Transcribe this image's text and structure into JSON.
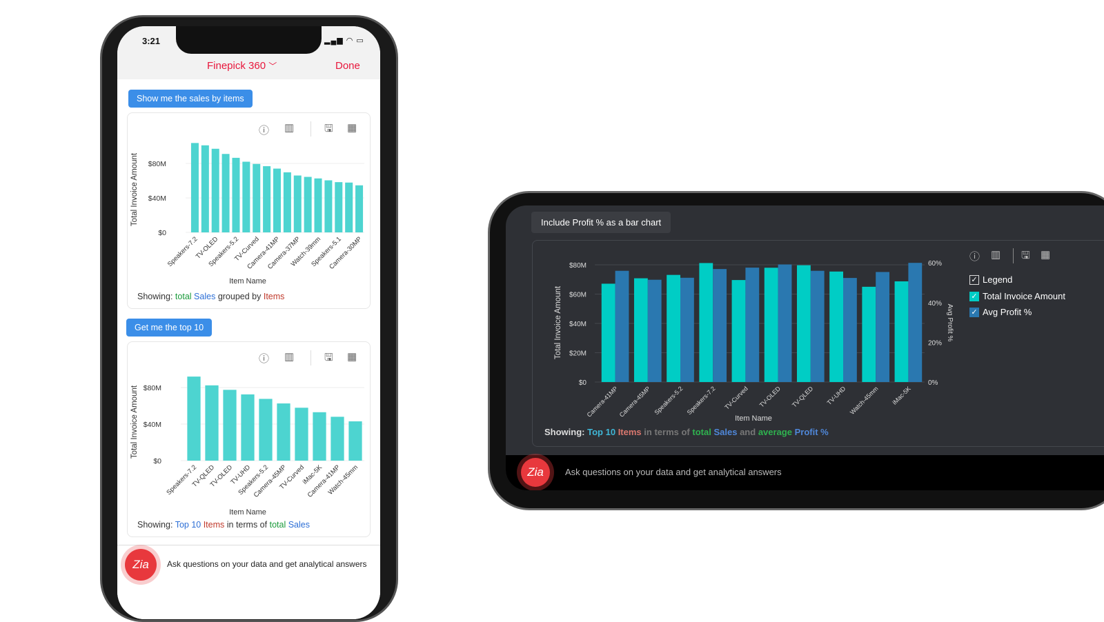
{
  "phone1": {
    "time": "3:21",
    "status_icons": "signal wifi battery",
    "title": "Finepick 360",
    "done": "Done",
    "query1": "Show me the sales by items",
    "query2": "Get me the top 10",
    "showing1": {
      "prefix": "Showing:",
      "w1": "total",
      "w2": "Sales",
      "w3": "grouped by",
      "w4": "Items"
    },
    "showing2": {
      "prefix": "Showing:",
      "w1": "Top 10",
      "w2": "Items",
      "w3": "in terms of",
      "w4": "total",
      "w5": "Sales"
    },
    "ask": "Ask questions on your data and get analytical answers",
    "zia": "Zia"
  },
  "phone2": {
    "query": "Include Profit % as a bar chart",
    "legend": {
      "title": "Legend",
      "items": [
        "Total Invoice Amount",
        "Avg Profit %"
      ]
    },
    "showing": {
      "prefix": "Showing:",
      "w1": "Top 10",
      "w2": "Items",
      "w3": "in terms of",
      "w4": "total",
      "w5": "Sales",
      "w6": "and",
      "w7": "average",
      "w8": "Profit %"
    },
    "ask": "Ask questions on your data and get analytical answers",
    "zia": "Zia"
  },
  "colors": {
    "accent": "#e8173c",
    "bubble": "#3b8ee8",
    "bar_light": "#4dd4d0",
    "bar_cyan": "#00cdc5",
    "bar_blue": "#2a78b0"
  },
  "chart_data": [
    {
      "type": "bar",
      "xlabel": "Item Name",
      "ylabel": "Total Invoice Amount",
      "ylim": [
        0,
        105
      ],
      "yticks": [
        "$0",
        "$40M",
        "$80M"
      ],
      "categories": [
        "Speakers-7.2",
        "",
        "TV-OLED",
        "",
        "Speakers-5.2",
        "",
        "TV-Curved",
        "",
        "Camera-41MP",
        "",
        "Camera-37MP",
        "",
        "Watch-39mm",
        "",
        "Speakers-5.1",
        "",
        "Camera-30MP"
      ],
      "values": [
        103.7,
        101,
        97,
        91,
        86.5,
        82,
        79.4,
        76.8,
        74,
        69.7,
        66,
        64.4,
        62.6,
        60.4,
        58.3,
        57.8,
        54.6
      ]
    },
    {
      "type": "bar",
      "xlabel": "Item Name",
      "ylabel": "Total Invoice Amount",
      "ylim": [
        0,
        95
      ],
      "yticks": [
        "$0",
        "$40M",
        "$80M"
      ],
      "categories": [
        "Speakers-7.2",
        "TV-QLED",
        "TV-OLED",
        "TV-UHD",
        "Speakers-5.2",
        "Camera-45MP",
        "TV-Curved",
        "iMac-5K",
        "Camera-41MP",
        "Watch-45mm"
      ],
      "values": [
        92,
        82.4,
        77.5,
        72.5,
        67.6,
        62.6,
        57.9,
        53,
        48,
        43
      ]
    },
    {
      "type": "bar",
      "xlabel": "Item Name",
      "ylabel": "Total Invoice Amount",
      "y2label": "Avg Profit %",
      "ylim": [
        0,
        80
      ],
      "y2lim": [
        0,
        60
      ],
      "yticks": [
        "$0",
        "$20M",
        "$40M",
        "$60M",
        "$80M"
      ],
      "y2ticks": [
        "0%",
        "20%",
        "40%",
        "60%"
      ],
      "categories": [
        "Camera-41MP",
        "Camera-45MP",
        "Speakers-5.2",
        "Speakers-7.2",
        "TV-Curved",
        "TV-OLED",
        "TV-QLED",
        "TV-UHD",
        "Watch-45mm",
        "iMac-5K"
      ],
      "series": [
        {
          "name": "Total Invoice Amount",
          "values": [
            67.1,
            70.8,
            73.1,
            81.2,
            69.6,
            78,
            79.7,
            75.4,
            65,
            68.7
          ]
        },
        {
          "name": "Avg Profit %",
          "values": [
            56,
            51.5,
            52.5,
            56.9,
            57.6,
            59.2,
            56,
            52.4,
            55.4,
            60
          ]
        }
      ]
    }
  ]
}
